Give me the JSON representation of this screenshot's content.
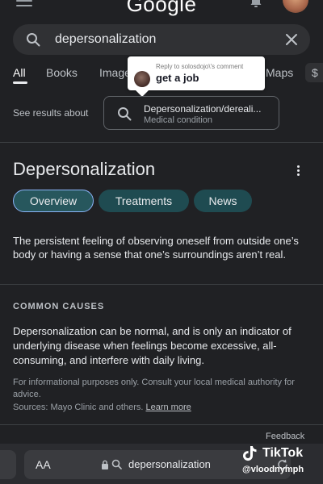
{
  "header": {
    "logo_text": "Google",
    "menu_icon": "hamburger-menu-icon",
    "notification_icon": "bell-icon"
  },
  "search": {
    "query": "depersonalization",
    "search_icon": "search-icon",
    "clear_icon": "close-icon"
  },
  "tabs": [
    {
      "label": "All",
      "active": true
    },
    {
      "label": "Books"
    },
    {
      "label": "Images"
    },
    {
      "label": "Maps"
    }
  ],
  "tabs_more": "$",
  "reply_bubble": {
    "header": "Reply to solosdojo\\'s comment",
    "text": "get a job"
  },
  "see_results": {
    "label": "See results about",
    "title": "Depersonalization/dereali...",
    "subtitle": "Medical condition"
  },
  "knowledge_panel": {
    "title": "Depersonalization",
    "more_icon": "more-vert-icon",
    "chips": [
      "Overview",
      "Treatments",
      "News"
    ],
    "description": "The persistent feeling of observing oneself from outside one’s body or having a sense that one’s surroundings aren’t real."
  },
  "causes": {
    "heading": "COMMON CAUSES",
    "text": "Depersonalization can be normal, and is only an indicator of underlying disease when feelings become excessive, all-consuming, and interfere with daily living.",
    "disclaimer": "For informational purposes only. Consult your local medical authority for advice.",
    "sources_prefix": "Sources: Mayo Clinic and others.",
    "learn_more": "Learn more"
  },
  "feedback": "Feedback",
  "browser_bar": {
    "aa_label": "AA",
    "url_text": "depersonalization"
  },
  "watermark": {
    "app_name": "TikTok",
    "username": "@vloodnymph"
  },
  "colors": {
    "background": "#202124",
    "chip_background": "#1f4b51",
    "chip_active_border": "#8ab4f8"
  }
}
